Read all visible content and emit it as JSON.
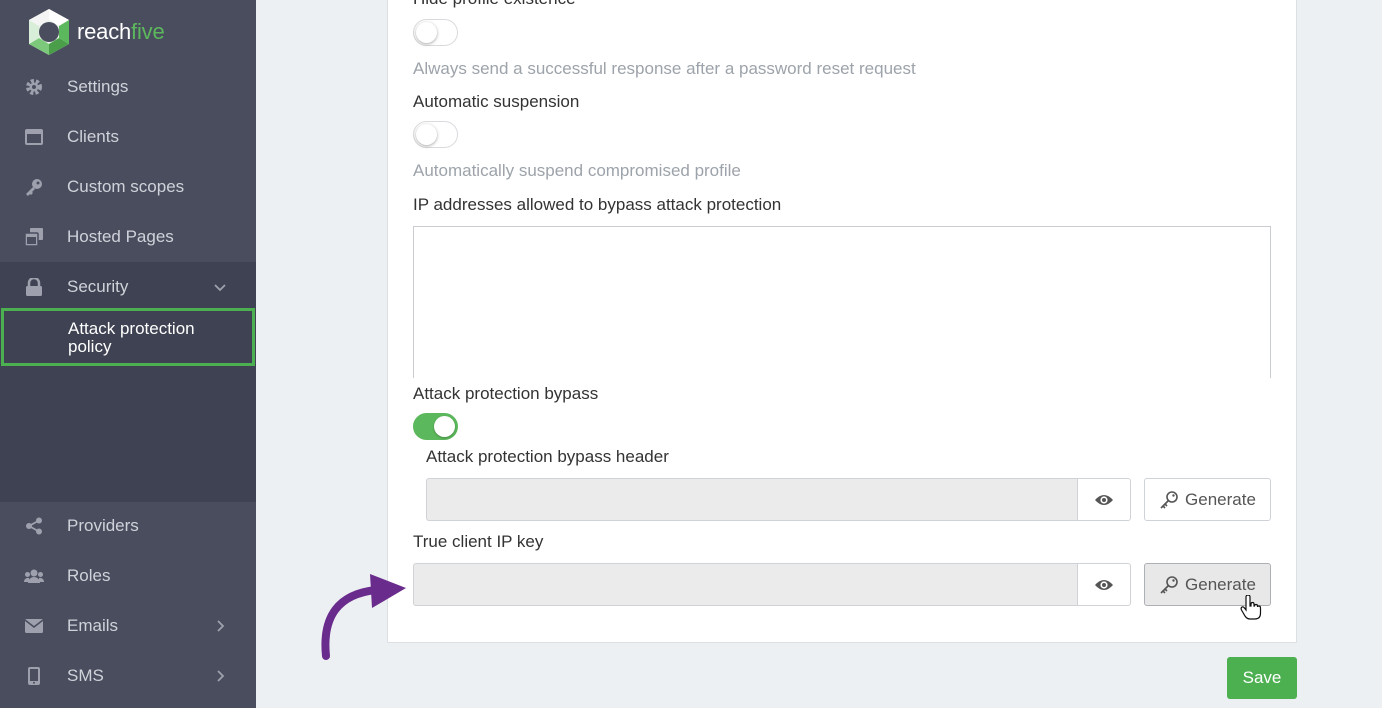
{
  "app": {
    "brand_part1": "reach",
    "brand_part2": "five"
  },
  "sidebar": {
    "items": [
      {
        "label": "Settings",
        "icon": "gear-icon"
      },
      {
        "label": "Clients",
        "icon": "card-icon"
      },
      {
        "label": "Custom scopes",
        "icon": "key-icon"
      },
      {
        "label": "Hosted Pages",
        "icon": "pages-icon"
      },
      {
        "label": "Security",
        "icon": "lock-icon"
      },
      {
        "label": "Providers",
        "icon": "share-icon"
      },
      {
        "label": "Roles",
        "icon": "users-icon"
      },
      {
        "label": "Emails",
        "icon": "envelope-icon"
      },
      {
        "label": "SMS",
        "icon": "phone-icon"
      }
    ],
    "security_sub": {
      "label_line1": "Attack protection",
      "label_line2": "policy"
    }
  },
  "form": {
    "hide_profile": {
      "label": "Hide profile existence",
      "enabled": false,
      "help": "Always send a successful response after a password reset request"
    },
    "auto_suspension": {
      "label": "Automatic suspension",
      "enabled": false,
      "help": "Automatically suspend compromised profile"
    },
    "ip_addresses": {
      "label": "IP addresses allowed to bypass attack protection",
      "value": ""
    },
    "bypass": {
      "label": "Attack protection bypass",
      "enabled": true
    },
    "bypass_header": {
      "label": "Attack protection bypass header",
      "value": "",
      "generate_label": "Generate"
    },
    "true_client_ip": {
      "label": "True client IP key",
      "value": "",
      "generate_label": "Generate"
    }
  },
  "actions": {
    "save_label": "Save"
  },
  "colors": {
    "sidebar": "#4a4d5e",
    "accent_green": "#4caf50",
    "annotation_arrow": "#6a2c8c"
  }
}
